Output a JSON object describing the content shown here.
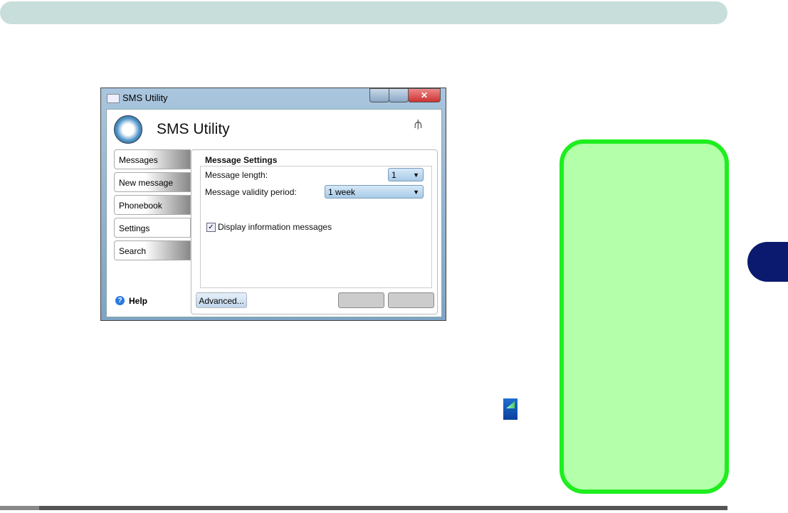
{
  "window": {
    "title": "SMS Utility",
    "app_title": "SMS Utility"
  },
  "tabs": [
    {
      "label": "Messages"
    },
    {
      "label": "New message"
    },
    {
      "label": "Phonebook"
    },
    {
      "label": "Settings"
    },
    {
      "label": "Search"
    }
  ],
  "help_label": "Help",
  "settings": {
    "group_title": "Message Settings",
    "length_label": "Message length:",
    "length_value": "1",
    "validity_label": "Message validity period:",
    "validity_value": "1 week",
    "display_info_label": "Display information messages",
    "display_info_checked": true
  },
  "buttons": {
    "advanced": "Advanced..."
  },
  "colors": {
    "green_border": "#1eee1e",
    "green_fill": "#b3ffaa",
    "side_tab": "#0b1a6e",
    "top_bar": "#c8dedb"
  }
}
